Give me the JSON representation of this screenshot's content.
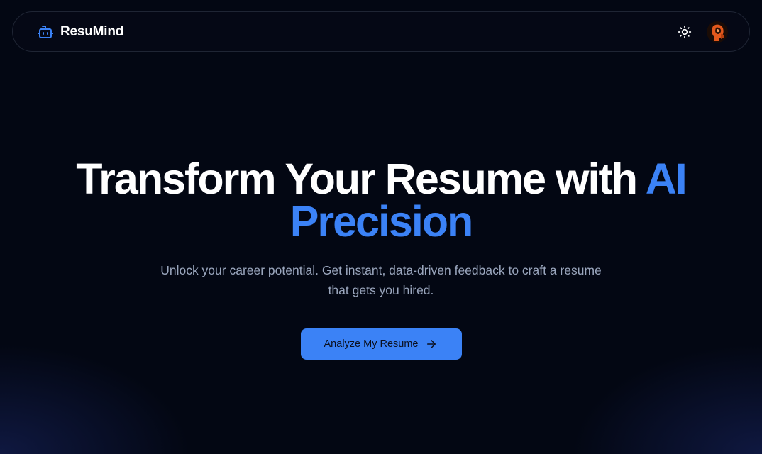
{
  "brand": {
    "name": "ResuMind",
    "icon": "robot-icon",
    "color": "#3b82f6"
  },
  "nav": {
    "theme_toggle_icon": "sun-icon",
    "avatar_icon": "user-avatar"
  },
  "hero": {
    "title_main": "Transform Your Resume with ",
    "title_accent": "AI Precision",
    "subtitle": "Unlock your career potential. Get instant, data-driven feedback to craft a resume that gets you hired.",
    "cta_label": "Analyze My Resume",
    "cta_icon": "arrow-right-icon"
  },
  "colors": {
    "background": "#030713",
    "accent": "#3b82f6",
    "text_primary": "#ffffff",
    "text_secondary": "#9aa6bd"
  }
}
